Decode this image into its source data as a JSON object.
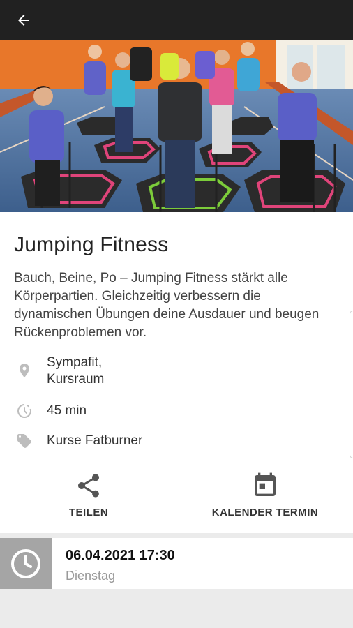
{
  "topbar": {
    "back_icon": "arrow-left-icon"
  },
  "hero": {
    "image_subject": "jumping-fitness-class-photo"
  },
  "course": {
    "title": "Jumping Fitness",
    "description": "Bauch, Beine, Po – Jumping Fitness stärkt alle Körperpartien. Gleichzeitig verbessern die dynamischen Übungen deine Ausdauer und beugen Rückenproblemen vor.",
    "location_line1": "Sympafit,",
    "location_line2": "Kursraum",
    "duration": "45 min",
    "category": "Kurse Fatburner"
  },
  "actions": {
    "share_label": "TEILEN",
    "calendar_label": "KALENDER TERMIN"
  },
  "schedule": {
    "datetime": "06.04.2021 17:30",
    "weekday": "Dienstag"
  },
  "colors": {
    "topbar": "#212121",
    "icon_gray": "#bdbdbd",
    "action_icon": "#555555",
    "clock_box": "#a5a5a5",
    "background": "#ebebeb"
  }
}
